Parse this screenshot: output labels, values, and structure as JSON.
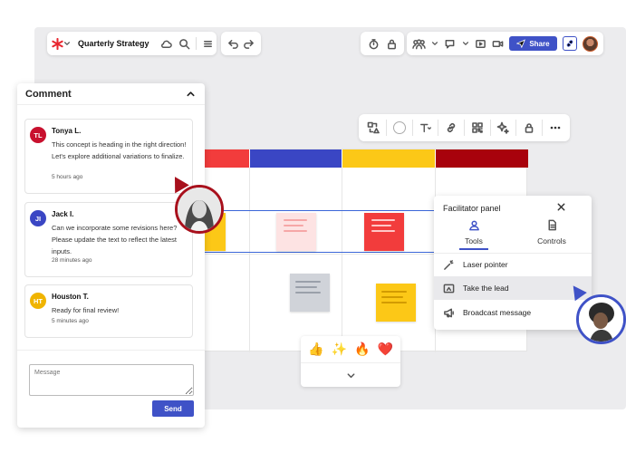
{
  "app": {
    "title": "Quarterly Strategy",
    "share_label": "Share"
  },
  "colors": {
    "accent": "#3f52c7",
    "red": "#f23c3c",
    "blue": "#3a46c4",
    "yellow": "#fcc817",
    "darkred": "#a8020c"
  },
  "comment_panel": {
    "title": "Comment",
    "comments": [
      {
        "initials": "TL",
        "name": "Tonya L.",
        "text": "This concept is heading in the right direction! Let's explore additional variations to finalize.",
        "time": "5 hours ago",
        "color": "#c8102e"
      },
      {
        "initials": "JI",
        "name": "Jack I.",
        "text": "Can we incorporate some revisions here? Please update the text to reflect the latest inputs.",
        "time": "28 minutes ago",
        "color": "#3a46c4"
      },
      {
        "initials": "HT",
        "name": "Houston T.",
        "text": "Ready for final review!",
        "time": "5 minutes ago",
        "color": "#f0b400"
      }
    ],
    "message_placeholder": "Message",
    "send_label": "Send"
  },
  "facilitator": {
    "title": "Facilitator panel",
    "tabs": [
      {
        "label": "Tools"
      },
      {
        "label": "Controls"
      }
    ],
    "items": [
      {
        "label": "Laser pointer"
      },
      {
        "label": "Take the lead"
      },
      {
        "label": "Broadcast message"
      }
    ]
  },
  "reactions": {
    "emojis": [
      "👍",
      "✨",
      "🔥",
      "❤️"
    ]
  }
}
